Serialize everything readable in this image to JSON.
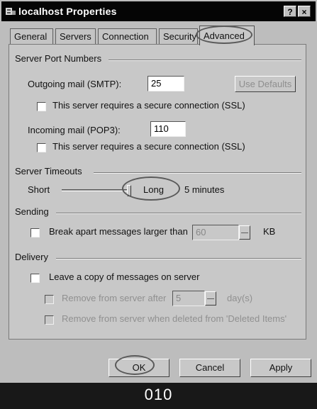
{
  "window": {
    "title": "localhost Properties",
    "help_button": "?",
    "close_button": "×"
  },
  "tabs": [
    {
      "label": "General"
    },
    {
      "label": "Servers"
    },
    {
      "label": "Connection"
    },
    {
      "label": "Security"
    },
    {
      "label": "Advanced",
      "selected": true
    }
  ],
  "port_numbers": {
    "group_label": "Server Port Numbers",
    "smtp_label": "Outgoing mail (SMTP):",
    "smtp_value": "25",
    "use_defaults": "Use Defaults",
    "smtp_ssl_label": "This server requires a secure connection (SSL)",
    "pop3_label": "Incoming mail (POP3):",
    "pop3_value": "110",
    "pop3_ssl_label": "This server requires a secure connection (SSL)"
  },
  "timeouts": {
    "group_label": "Server Timeouts",
    "short_label": "Short",
    "long_label": "Long",
    "value_text": "5 minutes",
    "level": 1.0
  },
  "sending": {
    "group_label": "Sending",
    "break_apart_label": "Break apart messages larger than",
    "size_value": "60",
    "unit": "KB"
  },
  "delivery": {
    "group_label": "Delivery",
    "leave_copy_label": "Leave a copy of messages on server",
    "remove_after_label": "Remove from server after",
    "days_value": "5",
    "days_unit": "day(s)",
    "remove_deleted_label": "Remove from server when deleted from 'Deleted Items'"
  },
  "buttons": {
    "ok": "OK",
    "cancel": "Cancel",
    "apply": "Apply"
  },
  "caption": "010"
}
